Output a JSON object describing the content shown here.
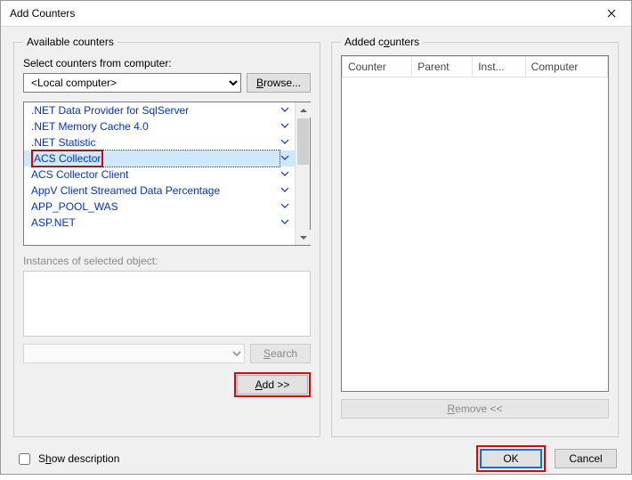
{
  "window": {
    "title": "Add Counters"
  },
  "left": {
    "legend": "Available counters",
    "select_label": "Select counters from computer:",
    "computer_value": "<Local computer>",
    "browse_label": "Browse...",
    "counters": [
      ".NET Data Provider for SqlServer",
      ".NET Memory Cache 4.0",
      ".NET Statistic",
      "ACS Collector",
      "ACS Collector Client",
      "AppV Client Streamed Data Percentage",
      "APP_POOL_WAS",
      "ASP.NET"
    ],
    "selected_index": 3,
    "instances_label": "Instances of selected object:",
    "search_label": "Search",
    "add_label": "Add >>"
  },
  "right": {
    "legend": "Added counters",
    "columns": [
      "Counter",
      "Parent",
      "Inst...",
      "Computer"
    ],
    "remove_label": "Remove <<"
  },
  "footer": {
    "show_desc_label": "Show description",
    "ok_label": "OK",
    "cancel_label": "Cancel"
  }
}
